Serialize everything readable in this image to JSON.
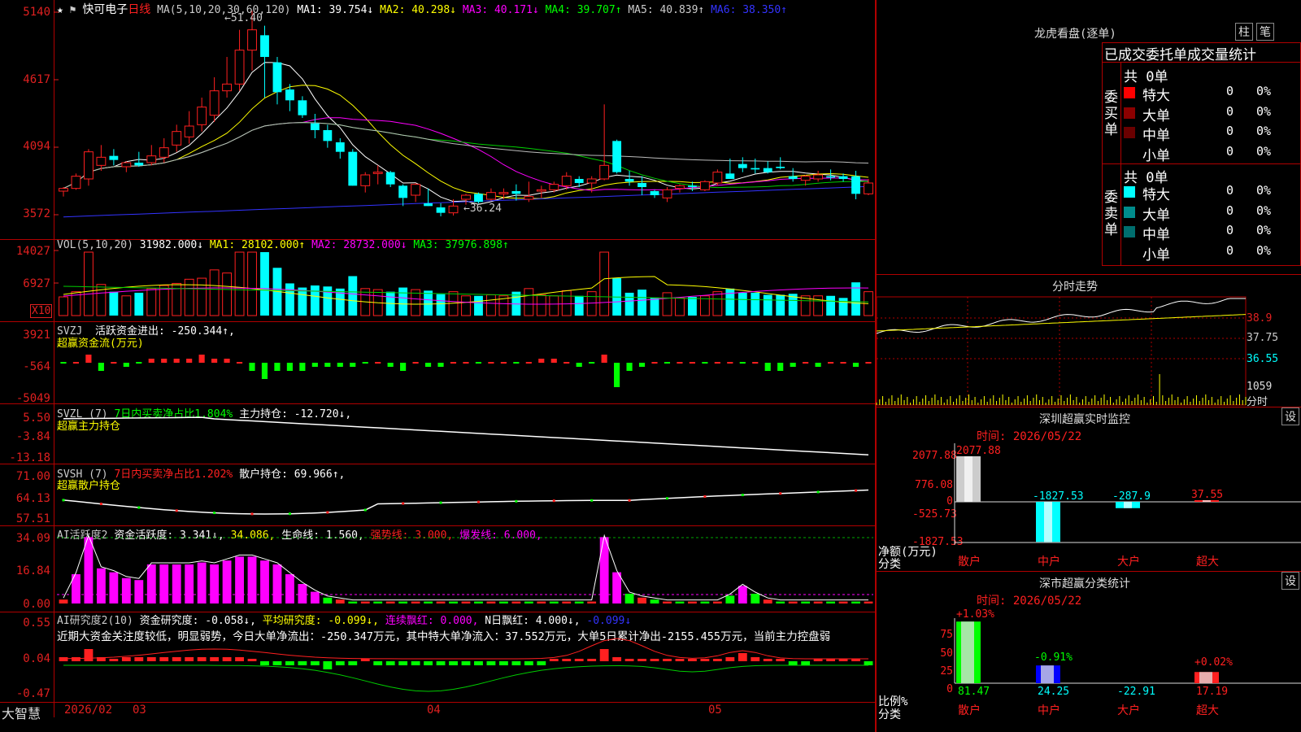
{
  "stock": {
    "name": "快可电子",
    "period": "日线",
    "star": "★",
    "flag": "⚑"
  },
  "main": {
    "ma_params": "MA(5,10,20,30,60,120)",
    "ma": [
      {
        "label": "MA1: 39.754↓",
        "color": "#ffffff"
      },
      {
        "label": "MA2: 40.298↓",
        "color": "#ffff00"
      },
      {
        "label": "MA3: 40.171↓",
        "color": "#ff00ff"
      },
      {
        "label": "MA4: 39.707↑",
        "color": "#00ff00"
      },
      {
        "label": "MA5: 40.839↑",
        "color": "#cccccc"
      },
      {
        "label": "MA6: 38.350↑",
        "color": "#3333ff"
      }
    ],
    "yticks": [
      "5140",
      "4617",
      "4094",
      "3572"
    ],
    "high_note": "←51.40",
    "low_note": "←36.24"
  },
  "vol": {
    "title": "VOL(5,10,20)",
    "value": "31982.000↓",
    "ma1": "MA1: 28102.000↑",
    "ma2": "MA2: 28732.000↓",
    "ma3": "MA3: 37976.898↑",
    "yticks": [
      "14027",
      "6927"
    ],
    "unit": "X10"
  },
  "svzj": {
    "title": "SVZJ",
    "label": "活跃资金进出: -250.344↑,",
    "sub": "超赢资金流(万元)",
    "yticks": [
      "3921",
      "-564",
      "-5049"
    ]
  },
  "svzl": {
    "title": "SVZL (7)",
    "ratio": "7日内买卖净占比1.804%",
    "hold": "主力持仓: -12.720↓,",
    "sub": "超赢主力持仓",
    "yticks": [
      "5.50",
      "-3.84",
      "-13.18"
    ]
  },
  "svsh": {
    "title": "SVSH (7)",
    "ratio": "7日内买卖净占比1.202%",
    "hold": "散户持仓: 69.966↑,",
    "sub": "超赢散户持仓",
    "yticks": [
      "71.00",
      "64.13",
      "57.51"
    ]
  },
  "ai_active": {
    "title": "AI活跃度2",
    "a": "资金活跃度: 3.341↓,",
    "b": "34.086,",
    "c": "生命线: 1.560,",
    "d": "强势线: 3.000,",
    "e": "爆发线: 6.000,",
    "yticks": [
      "34.09",
      "16.84",
      "0.00"
    ]
  },
  "ai_research": {
    "title": "AI研究度2(10)",
    "a": "资金研究度: -0.058↓,",
    "b": "平均研究度: -0.099↓,",
    "c": "连续飘红: 0.000,",
    "d": "N日飘红: 4.000↓,",
    "e": "-0.099↓",
    "comment": "近期大资金关注度较低，明显弱势，今日大单净流出：-250.347万元，其中特大单净流入：37.552万元，大单5日累计净出-2155.455万元，当前主力控盘弱",
    "yticks": [
      "0.55",
      "0.04",
      "-0.47"
    ]
  },
  "xaxis": {
    "brand": "大智慧",
    "labels": [
      "2026/02",
      "03",
      "04",
      "05"
    ]
  },
  "lhb": {
    "title": "龙虎看盘(逐单)",
    "btn1": "柱",
    "btn2": "笔",
    "header": "已成交委托单成交量统计",
    "buy_label": "委买单",
    "sell_label": "委卖单",
    "buy_total": "共 0单",
    "sell_total": "共 0单",
    "buy_rows": [
      {
        "name": "特大",
        "val": "0",
        "pct": "0%",
        "color": "#ff0000"
      },
      {
        "name": "大单",
        "val": "0",
        "pct": "0%",
        "color": "#8b0000"
      },
      {
        "name": "中单",
        "val": "0",
        "pct": "0%",
        "color": "#6a0000"
      },
      {
        "name": "小单",
        "val": "0",
        "pct": "0%",
        "color": "#000000"
      }
    ],
    "sell_rows": [
      {
        "name": "特大",
        "val": "0",
        "pct": "0%",
        "color": "#00ffff"
      },
      {
        "name": "大单",
        "val": "0",
        "pct": "0%",
        "color": "#008b8b"
      },
      {
        "name": "中单",
        "val": "0",
        "pct": "0%",
        "color": "#006e6e"
      },
      {
        "name": "小单",
        "val": "0",
        "pct": "0%",
        "color": "#000000"
      }
    ]
  },
  "fenshi": {
    "title": "分时走势",
    "yticks": [
      "38.9",
      "37.75",
      "36.55",
      "1059"
    ],
    "unit": "分时"
  },
  "monitor": {
    "title": "深圳超赢实时监控",
    "btn": "设",
    "time": "时间: 2026/05/22",
    "yticks": [
      "2077.88",
      "776.08",
      "0",
      "-525.73",
      "-1827.53"
    ],
    "ylabel": "净额(万元)",
    "xlabel": "分类",
    "cats": [
      "散户",
      "中户",
      "大户",
      "超大"
    ],
    "values": [
      "2077.88",
      "-1827.53",
      "-287.9",
      "37.55"
    ]
  },
  "classstat": {
    "title": "深市超赢分类统计",
    "btn": "设",
    "time": "时间: 2026/05/22",
    "yticks": [
      "75",
      "50",
      "25",
      "0"
    ],
    "ylabel": "比例%",
    "xlabel": "分类",
    "cats": [
      "散户",
      "中户",
      "大户",
      "超大"
    ],
    "top_labels": [
      "+1.03%",
      "-0.91%",
      "+0.02%"
    ],
    "values": [
      "81.47",
      "24.25",
      "-22.91",
      "17.19"
    ]
  },
  "chart_data": {
    "type": "candlestick",
    "title": "快可电子 日线",
    "note": "approximate daily candles read from screenshot (price in yuan)",
    "ylim": [
      35.7,
      51.6
    ],
    "candles": [
      [
        38.1,
        38.4,
        37.7,
        38.3
      ],
      [
        38.3,
        39.4,
        38.2,
        39.2
      ],
      [
        39.0,
        41.2,
        38.5,
        41.0
      ],
      [
        40.0,
        41.5,
        39.6,
        40.6
      ],
      [
        40.7,
        41.2,
        40.0,
        40.4
      ],
      [
        39.9,
        40.3,
        39.5,
        40.2
      ],
      [
        40.2,
        41.0,
        39.9,
        40.0
      ],
      [
        40.2,
        41.5,
        40.0,
        40.7
      ],
      [
        40.6,
        42.0,
        40.2,
        41.3
      ],
      [
        41.5,
        43.0,
        41.0,
        42.5
      ],
      [
        42.1,
        44.0,
        41.6,
        42.9
      ],
      [
        43.0,
        45.0,
        42.5,
        44.3
      ],
      [
        43.7,
        46.5,
        43.2,
        45.5
      ],
      [
        45.5,
        48.0,
        45.0,
        46.0
      ],
      [
        46.0,
        50.0,
        45.5,
        48.5
      ],
      [
        48.5,
        51.4,
        47.0,
        50.0
      ],
      [
        49.6,
        50.3,
        45.0,
        48.0
      ],
      [
        47.6,
        48.0,
        44.5,
        45.4
      ],
      [
        45.6,
        46.0,
        44.0,
        44.8
      ],
      [
        44.8,
        45.1,
        43.5,
        43.7
      ],
      [
        43.1,
        43.8,
        42.0,
        42.6
      ],
      [
        42.6,
        43.0,
        41.3,
        41.8
      ],
      [
        41.7,
        42.0,
        40.5,
        41.0
      ],
      [
        41.0,
        41.2,
        38.5,
        38.5
      ],
      [
        38.5,
        39.5,
        38.0,
        39.3
      ],
      [
        39.4,
        40.0,
        38.6,
        39.5
      ],
      [
        39.5,
        39.6,
        38.4,
        38.6
      ],
      [
        38.5,
        38.6,
        37.0,
        37.6
      ],
      [
        37.8,
        38.7,
        37.3,
        38.6
      ],
      [
        37.2,
        38.3,
        37.0,
        37.0
      ],
      [
        36.9,
        37.2,
        36.24,
        36.5
      ],
      [
        36.5,
        37.5,
        36.3,
        37.0
      ],
      [
        37.5,
        37.9,
        37.1,
        37.8
      ],
      [
        37.9,
        38.0,
        37.2,
        37.3
      ],
      [
        37.5,
        38.3,
        37.4,
        38.0
      ],
      [
        37.9,
        38.3,
        37.5,
        38.0
      ],
      [
        38.1,
        38.6,
        37.4,
        37.9
      ],
      [
        37.5,
        38.8,
        37.3,
        37.7
      ],
      [
        38.1,
        38.5,
        37.6,
        38.2
      ],
      [
        38.2,
        38.8,
        38.0,
        38.6
      ],
      [
        38.5,
        39.5,
        38.2,
        39.2
      ],
      [
        39.0,
        39.2,
        38.4,
        38.7
      ],
      [
        38.7,
        39.2,
        38.0,
        39.0
      ],
      [
        39.0,
        44.5,
        38.9,
        40.0
      ],
      [
        41.8,
        41.9,
        39.4,
        39.5
      ],
      [
        39.0,
        39.6,
        38.5,
        38.8
      ],
      [
        38.7,
        39.2,
        37.8,
        38.4
      ],
      [
        38.1,
        38.2,
        37.6,
        37.8
      ],
      [
        37.6,
        38.4,
        37.3,
        38.2
      ],
      [
        38.3,
        38.6,
        38.0,
        38.5
      ],
      [
        38.5,
        38.8,
        38.1,
        38.4
      ],
      [
        38.2,
        38.9,
        38.1,
        38.8
      ],
      [
        38.7,
        39.7,
        38.5,
        39.5
      ],
      [
        39.4,
        40.5,
        39.0,
        39.0
      ],
      [
        40.1,
        40.6,
        39.5,
        39.8
      ],
      [
        39.8,
        40.5,
        39.4,
        39.7
      ],
      [
        39.8,
        40.3,
        39.4,
        39.5
      ],
      [
        39.9,
        40.6,
        39.7,
        39.8
      ],
      [
        39.2,
        39.8,
        38.8,
        39.0
      ],
      [
        38.9,
        39.3,
        38.5,
        39.2
      ],
      [
        39.0,
        39.6,
        38.8,
        39.3
      ],
      [
        39.2,
        39.7,
        38.9,
        39.1
      ],
      [
        39.2,
        39.4,
        38.8,
        39.0
      ],
      [
        39.2,
        39.6,
        37.5,
        37.9
      ],
      [
        37.9,
        39.0,
        37.8,
        38.7
      ]
    ],
    "monitor_net": {
      "categories": [
        "散户",
        "中户",
        "大户",
        "超大"
      ],
      "values": [
        2077.88,
        -1827.53,
        -287.9,
        37.55
      ]
    },
    "class_ratio": {
      "categories": [
        "散户",
        "中户",
        "大户",
        "超大"
      ],
      "values": [
        81.47,
        24.25,
        -22.91,
        17.19
      ]
    }
  }
}
